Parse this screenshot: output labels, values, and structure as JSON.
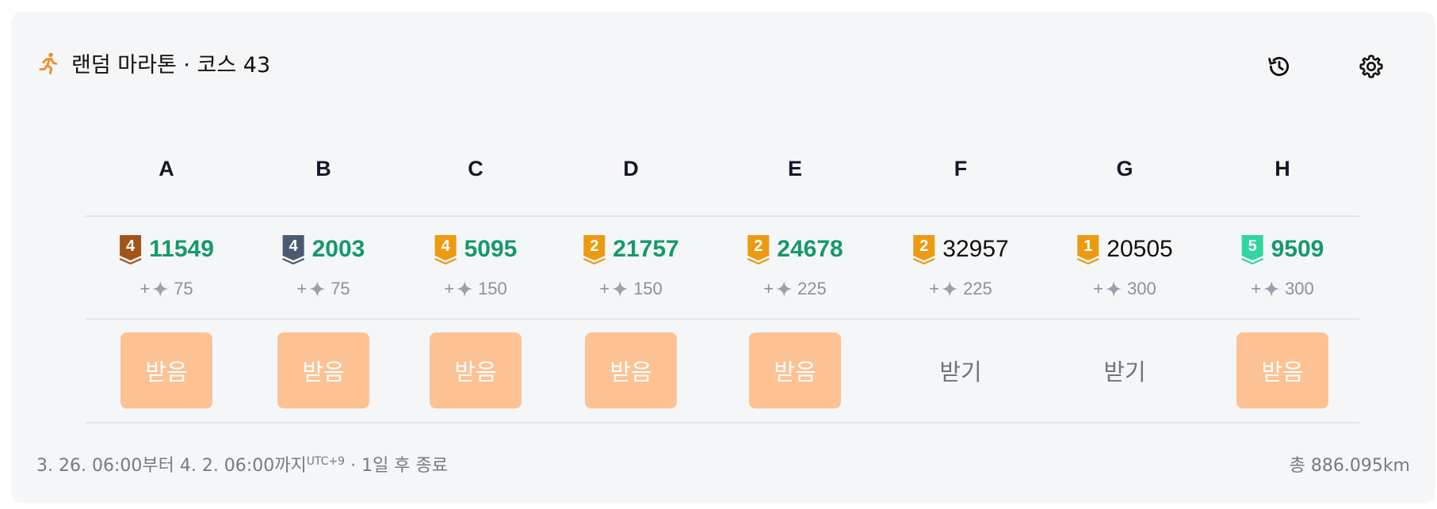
{
  "header": {
    "title": "랜덤 마라톤 · 코스 43",
    "runner_icon": "runner-icon",
    "history_icon": "history-icon",
    "settings_icon": "gear-icon",
    "accent": "#f08c1e"
  },
  "columns": [
    {
      "label": "A",
      "rank": "4",
      "badge_color": "#a0531a",
      "score": "11549",
      "score_style": "green",
      "reward": "75",
      "claim": "받음",
      "claimed": true
    },
    {
      "label": "B",
      "rank": "4",
      "badge_color": "#4b5a70",
      "score": "2003",
      "score_style": "green",
      "reward": "75",
      "claim": "받음",
      "claimed": true
    },
    {
      "label": "C",
      "rank": "4",
      "badge_color": "#ec9a12",
      "score": "5095",
      "score_style": "green",
      "reward": "150",
      "claim": "받음",
      "claimed": true
    },
    {
      "label": "D",
      "rank": "2",
      "badge_color": "#ec9a12",
      "score": "21757",
      "score_style": "green",
      "reward": "150",
      "claim": "받음",
      "claimed": true
    },
    {
      "label": "E",
      "rank": "2",
      "badge_color": "#ec9a12",
      "score": "24678",
      "score_style": "green",
      "reward": "225",
      "claim": "받음",
      "claimed": true
    },
    {
      "label": "F",
      "rank": "2",
      "badge_color": "#ec9a12",
      "score": "32957",
      "score_style": "black",
      "reward": "225",
      "claim": "받기",
      "claimed": false
    },
    {
      "label": "G",
      "rank": "1",
      "badge_color": "#ec9a12",
      "score": "20505",
      "score_style": "black",
      "reward": "300",
      "claim": "받기",
      "claimed": false
    },
    {
      "label": "H",
      "rank": "5",
      "badge_color": "#2fd6a0",
      "score": "9509",
      "score_style": "green",
      "reward": "300",
      "claim": "받음",
      "claimed": true
    }
  ],
  "reward_prefix": "+",
  "footer": {
    "period": "3. 26. 06:00부터 4. 2. 06:00까지",
    "timezone": "UTC+9",
    "remaining": " · 1일 후 종료",
    "total": "총 886.095km"
  },
  "colors": {
    "green": "#15996b",
    "claimed_bg": "#fcc293",
    "panel_bg": "#f5f6f8"
  }
}
